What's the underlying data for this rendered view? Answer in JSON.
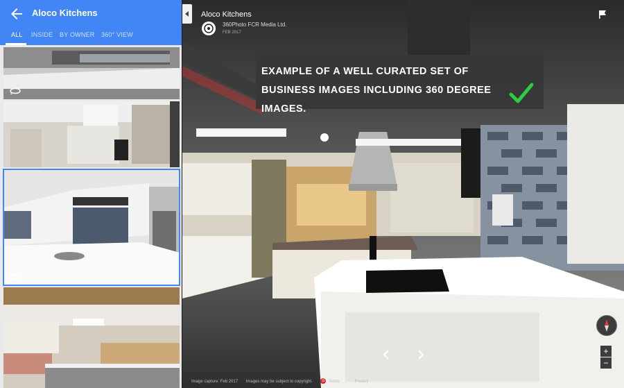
{
  "sidebar": {
    "title": "Aloco Kitchens",
    "tabs": [
      "ALL",
      "INSIDE",
      "BY OWNER",
      "360° VIEW"
    ],
    "active_tab": "ALL",
    "thumbnails": [
      {
        "kind": "360",
        "selected": false
      },
      {
        "kind": "photo",
        "selected": false
      },
      {
        "kind": "360",
        "selected": true
      },
      {
        "kind": "photo",
        "selected": false
      }
    ]
  },
  "viewer": {
    "place_name": "Aloco Kitchens",
    "author": "360Photo FCR Media Ltd.",
    "date": "FEB 2017",
    "callout": "EXAMPLE OF A WELL CURATED SET OF BUSINESS IMAGES INCLUDING 360 DEGREE IMAGES.",
    "zoom_in": "+",
    "zoom_out": "−"
  },
  "footer": {
    "capture": "Image capture: Feb 2017",
    "copyright": "Images may be subject to copyright.",
    "terms": "Terms",
    "privacy": "Privacy"
  },
  "colors": {
    "header_blue": "#4285f4",
    "check_green": "#2ecc40"
  },
  "icons": [
    "back-arrow-icon",
    "flag-icon",
    "rotate-360-icon",
    "chevron-left-icon",
    "chevron-right-icon",
    "compass-icon",
    "checkmark-icon",
    "collapse-arrow-icon"
  ]
}
